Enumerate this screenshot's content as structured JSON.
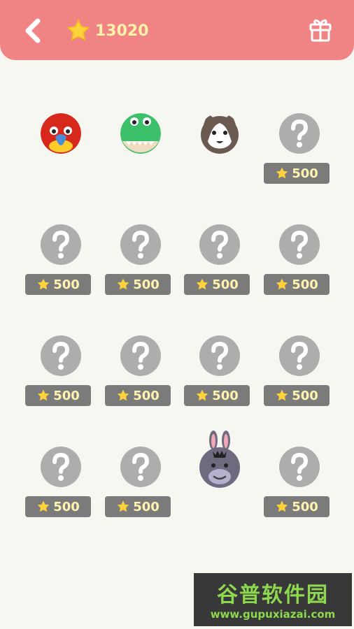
{
  "header": {
    "score": "13020",
    "accent": "#f08485",
    "icons": [
      "back-arrow-icon",
      "star-icon",
      "gift-icon"
    ]
  },
  "grid": {
    "cells": [
      {
        "type": "avatar",
        "name": "parrot"
      },
      {
        "type": "avatar",
        "name": "crocodile"
      },
      {
        "type": "avatar",
        "name": "cat"
      },
      {
        "type": "locked",
        "price": "500"
      },
      {
        "type": "locked",
        "price": "500"
      },
      {
        "type": "locked",
        "price": "500"
      },
      {
        "type": "locked",
        "price": "500"
      },
      {
        "type": "locked",
        "price": "500"
      },
      {
        "type": "locked",
        "price": "500"
      },
      {
        "type": "locked",
        "price": "500"
      },
      {
        "type": "locked",
        "price": "500"
      },
      {
        "type": "locked",
        "price": "500"
      },
      {
        "type": "locked",
        "price": "500"
      },
      {
        "type": "locked",
        "price": "500"
      },
      {
        "type": "avatar",
        "name": "donkey"
      },
      {
        "type": "locked",
        "price": "500"
      }
    ]
  },
  "watermark": {
    "title": "谷普软件园",
    "url": "www.gupuxiazai.com"
  }
}
